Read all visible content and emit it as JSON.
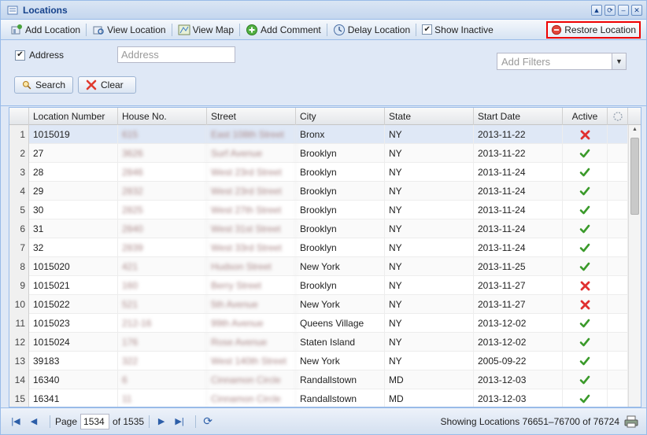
{
  "header": {
    "title": "Locations"
  },
  "toolbar": {
    "add_location": "Add Location",
    "view_location": "View Location",
    "view_map": "View Map",
    "add_comment": "Add Comment",
    "delay_location": "Delay Location",
    "show_inactive": "Show Inactive",
    "restore_location": "Restore Location"
  },
  "filters": {
    "address_label": "Address",
    "address_placeholder": "Address",
    "add_filters_placeholder": "Add Filters",
    "search_label": "Search",
    "clear_label": "Clear"
  },
  "grid": {
    "columns": [
      "Location Number",
      "House No.",
      "Street",
      "City",
      "State",
      "Start Date",
      "Active"
    ],
    "rows": [
      {
        "n": "1",
        "loc": "1015019",
        "house": "615",
        "street": "East 108th Street",
        "city": "Bronx",
        "state": "NY",
        "date": "2013-11-22",
        "active": false
      },
      {
        "n": "2",
        "loc": "27",
        "house": "3626",
        "street": "Surf Avenue",
        "city": "Brooklyn",
        "state": "NY",
        "date": "2013-11-22",
        "active": true
      },
      {
        "n": "3",
        "loc": "28",
        "house": "2846",
        "street": "West 23rd Street",
        "city": "Brooklyn",
        "state": "NY",
        "date": "2013-11-24",
        "active": true
      },
      {
        "n": "4",
        "loc": "29",
        "house": "2832",
        "street": "West 23rd Street",
        "city": "Brooklyn",
        "state": "NY",
        "date": "2013-11-24",
        "active": true
      },
      {
        "n": "5",
        "loc": "30",
        "house": "2825",
        "street": "West 27th Street",
        "city": "Brooklyn",
        "state": "NY",
        "date": "2013-11-24",
        "active": true
      },
      {
        "n": "6",
        "loc": "31",
        "house": "2840",
        "street": "West 31st Street",
        "city": "Brooklyn",
        "state": "NY",
        "date": "2013-11-24",
        "active": true
      },
      {
        "n": "7",
        "loc": "32",
        "house": "2839",
        "street": "West 33rd Street",
        "city": "Brooklyn",
        "state": "NY",
        "date": "2013-11-24",
        "active": true
      },
      {
        "n": "8",
        "loc": "1015020",
        "house": "421",
        "street": "Hudson Street",
        "city": "New York",
        "state": "NY",
        "date": "2013-11-25",
        "active": true
      },
      {
        "n": "9",
        "loc": "1015021",
        "house": "160",
        "street": "Berry Street",
        "city": "Brooklyn",
        "state": "NY",
        "date": "2013-11-27",
        "active": false
      },
      {
        "n": "10",
        "loc": "1015022",
        "house": "521",
        "street": "5th Avenue",
        "city": "New York",
        "state": "NY",
        "date": "2013-11-27",
        "active": false
      },
      {
        "n": "11",
        "loc": "1015023",
        "house": "212-16",
        "street": "99th Avenue",
        "city": "Queens Village",
        "state": "NY",
        "date": "2013-12-02",
        "active": true
      },
      {
        "n": "12",
        "loc": "1015024",
        "house": "176",
        "street": "Rose Avenue",
        "city": "Staten Island",
        "state": "NY",
        "date": "2013-12-02",
        "active": true
      },
      {
        "n": "13",
        "loc": "39183",
        "house": "322",
        "street": "West 140th Street",
        "city": "New York",
        "state": "NY",
        "date": "2005-09-22",
        "active": true
      },
      {
        "n": "14",
        "loc": "16340",
        "house": "6",
        "street": "Cinnamon Circle",
        "city": "Randallstown",
        "state": "MD",
        "date": "2013-12-03",
        "active": true
      },
      {
        "n": "15",
        "loc": "16341",
        "house": "11",
        "street": "Cinnamon Circle",
        "city": "Randallstown",
        "state": "MD",
        "date": "2013-12-03",
        "active": true
      }
    ]
  },
  "pager": {
    "page_label": "Page",
    "page_value": "1534",
    "of_label": "of 1535",
    "info": "Showing Locations 76651–76700 of 76724"
  },
  "colors": {
    "accent": "#15428b",
    "restore_border": "#ee0000",
    "check": "#3a9a2a",
    "cross": "#e03030"
  }
}
